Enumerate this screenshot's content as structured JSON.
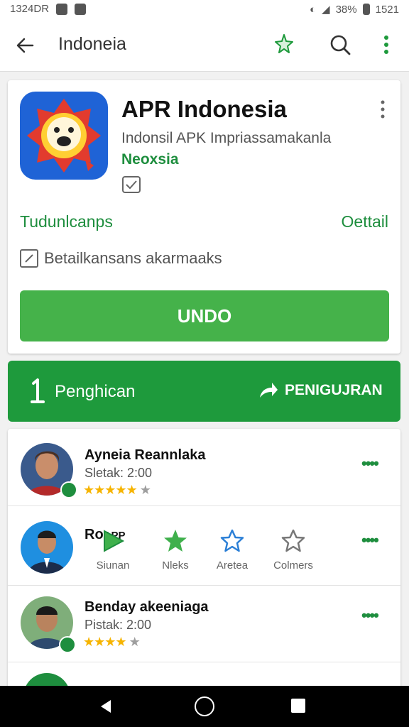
{
  "status_bar": {
    "left_text": "1324DR",
    "battery": "38%",
    "time": "1521"
  },
  "app_bar": {
    "title": "Indoneia"
  },
  "app": {
    "name": "APR Indonesia",
    "subtitle": "Indonsil APK Impriassamakanla",
    "developer": "Neoxsia",
    "row_left": "Tudunlcanps",
    "row_right": "Oettail",
    "check_label": "Betailkansans akarmaaks",
    "undo_label": "UNDO"
  },
  "action_bar": {
    "left_label": "Penghican",
    "right_label": "PENIGUJRAN"
  },
  "reviews": [
    {
      "name": "Ayneia Reannlaka",
      "time": "Sletak: 2:00",
      "rating": 4,
      "stars_filled": "★★★★★",
      "stars_empty": "★"
    },
    {
      "name": "Ro",
      "name_suffix": "APP",
      "time": "",
      "rating": 0
    },
    {
      "name": "Benday akeeniaga",
      "time": "Pistak: 2:00",
      "rating": 4,
      "stars_filled": "★★★★",
      "stars_empty": "★"
    }
  ],
  "review_actions": [
    {
      "label": "Siunan",
      "icon": "play-icon"
    },
    {
      "label": "Nleks",
      "icon": "star-filled-icon"
    },
    {
      "label": "Aretea",
      "icon": "star-outline-blue-icon"
    },
    {
      "label": "Colmers",
      "icon": "star-outline-gray-icon"
    }
  ],
  "colors": {
    "accent_green": "#1e9a3c",
    "button_green": "#45b24a",
    "star_gold": "#f6b400"
  }
}
